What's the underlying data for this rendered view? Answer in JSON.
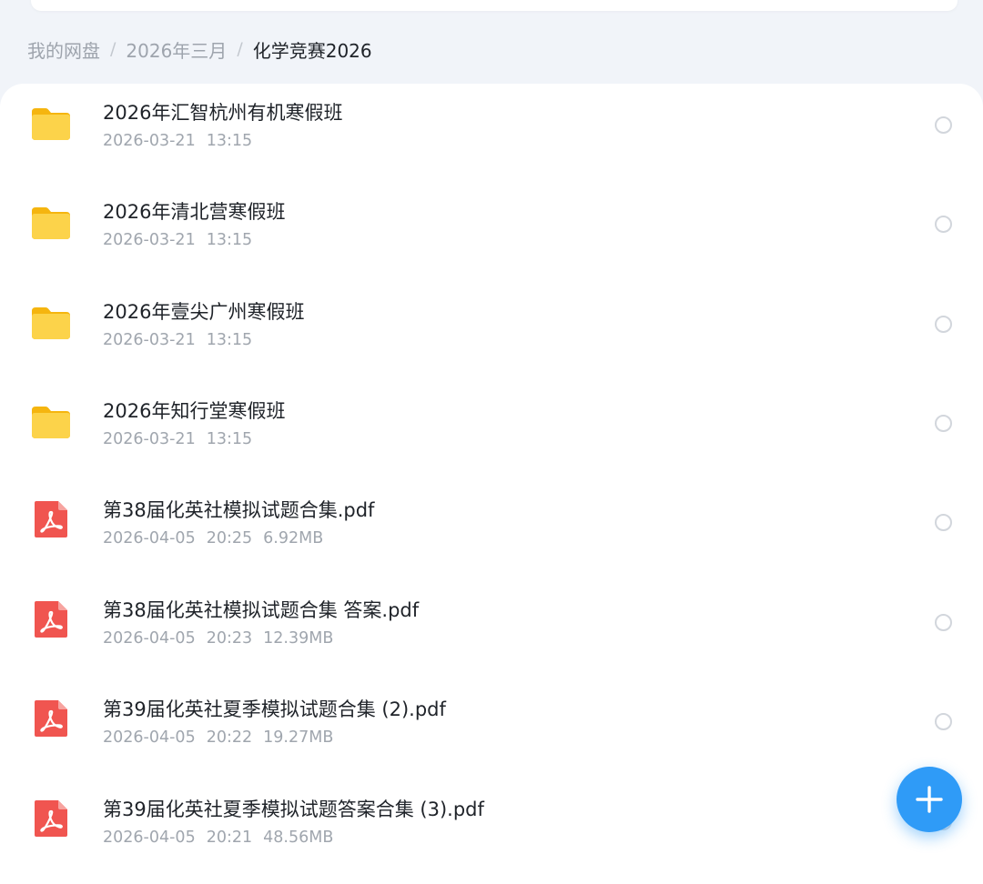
{
  "breadcrumb": {
    "items": [
      "我的网盘",
      "2026年三月",
      "化学竞赛2026"
    ],
    "separator": "/"
  },
  "files": [
    {
      "name": "2026年汇智杭州有机寒假班",
      "date": "2026-03-21",
      "time": "13:15",
      "size": "",
      "icon": "folder-icon"
    },
    {
      "name": "2026年清北营寒假班",
      "date": "2026-03-21",
      "time": "13:15",
      "size": "",
      "icon": "folder-icon"
    },
    {
      "name": "2026年壹尖广州寒假班",
      "date": "2026-03-21",
      "time": "13:15",
      "size": "",
      "icon": "folder-icon"
    },
    {
      "name": "2026年知行堂寒假班",
      "date": "2026-03-21",
      "time": "13:15",
      "size": "",
      "icon": "folder-icon"
    },
    {
      "name": "第38届化英社模拟试题合集.pdf",
      "date": "2026-04-05",
      "time": "20:25",
      "size": "6.92MB",
      "icon": "pdf-icon"
    },
    {
      "name": "第38届化英社模拟试题合集 答案.pdf",
      "date": "2026-04-05",
      "time": "20:23",
      "size": "12.39MB",
      "icon": "pdf-icon"
    },
    {
      "name": "第39届化英社夏季模拟试题合集 (2).pdf",
      "date": "2026-04-05",
      "time": "20:22",
      "size": "19.27MB",
      "icon": "pdf-icon"
    },
    {
      "name": "第39届化英社夏季模拟试题答案合集 (3).pdf",
      "date": "2026-04-05",
      "time": "20:21",
      "size": "48.56MB",
      "icon": "pdf-icon"
    }
  ],
  "fab": {
    "icon": "plus-icon"
  },
  "colors": {
    "accent": "#2f9bf7",
    "folder": "#f9c21d",
    "pdf": "#ef5350",
    "background": "#f1f4f9"
  }
}
